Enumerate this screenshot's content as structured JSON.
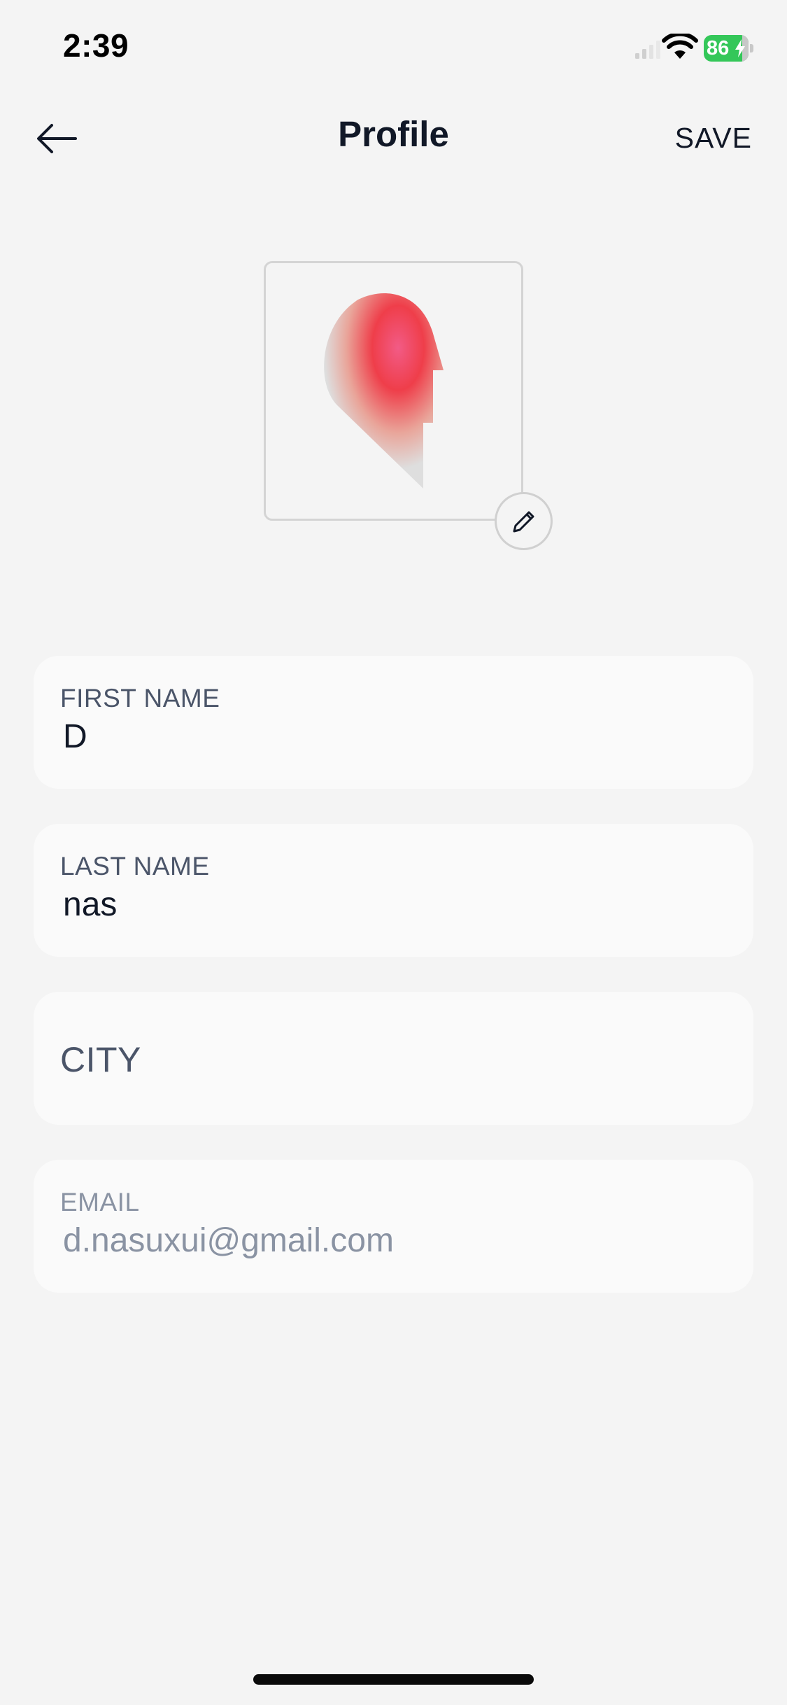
{
  "status_bar": {
    "time": "2:39",
    "battery_level": "86",
    "battery_color": "#34c759"
  },
  "header": {
    "back_icon": "arrow-left-icon",
    "title": "Profile",
    "save_label": "SAVE"
  },
  "avatar": {
    "edit_icon": "pencil-icon",
    "accent_colors": [
      "#f05a7e",
      "#ef3e4a",
      "#d9d9d9"
    ]
  },
  "fields": {
    "first_name": {
      "label": "FIRST NAME",
      "value": "D"
    },
    "last_name": {
      "label": "LAST NAME",
      "value": "nas"
    },
    "city": {
      "placeholder": "CITY"
    },
    "email": {
      "label": "EMAIL",
      "value": "d.nasuxui@gmail.com"
    }
  }
}
